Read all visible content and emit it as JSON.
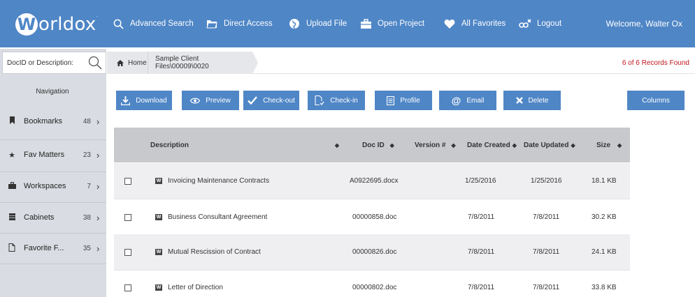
{
  "header": {
    "logo_letter": "W",
    "logo_text": "orldox",
    "nav": [
      {
        "label": "Advanced Search",
        "icon": "search-icon"
      },
      {
        "label": "Direct Access",
        "icon": "folder-icon"
      },
      {
        "label": "Upload File",
        "icon": "globe-icon"
      },
      {
        "label": "Open Project",
        "icon": "briefcase-icon"
      },
      {
        "label": "All Favorites",
        "icon": "heart-icon"
      },
      {
        "label": "Logout",
        "icon": "logout-icon"
      }
    ],
    "welcome": "Welcome, Walter Ox"
  },
  "sidebar": {
    "search_placeholder": "DocID or Description:",
    "title": "Navigation",
    "items": [
      {
        "label": "Bookmarks",
        "count": "48",
        "icon": "bookmark-icon"
      },
      {
        "label": "Fav Matters",
        "count": "23",
        "icon": "star-icon"
      },
      {
        "label": "Workspaces",
        "count": "7",
        "icon": "briefcase-icon"
      },
      {
        "label": "Cabinets",
        "count": "38",
        "icon": "cabinet-icon"
      },
      {
        "label": "Favorite F...",
        "count": "35",
        "icon": "file-icon"
      }
    ]
  },
  "breadcrumb": {
    "home": "Home",
    "path": "Sample Client Files\\00009\\0020",
    "records": "6 of 6 Records Found"
  },
  "toolbar": {
    "download": "Download",
    "preview": "Preview",
    "checkout": "Check-out",
    "checkin": "Check-in",
    "profile": "Profile",
    "email": "Email",
    "delete": "Delete",
    "columns": "Columns"
  },
  "table": {
    "headers": {
      "description": "Description",
      "docid": "Doc ID",
      "version": "Version #",
      "created": "Date Created",
      "updated": "Date Updated",
      "size": "Size"
    },
    "rows": [
      {
        "description": "Invoicing Maintenance Contracts",
        "docid": "A0922695.docx",
        "version": "",
        "created": "1/25/2016",
        "updated": "1/25/2016",
        "size": "18.1 KB"
      },
      {
        "description": "Business Consultant Agreement",
        "docid": "00000858.doc",
        "version": "",
        "created": "7/8/2011",
        "updated": "7/8/2011",
        "size": "30.2 KB"
      },
      {
        "description": "Mutual Rescission of Contract",
        "docid": "00000826.doc",
        "version": "",
        "created": "7/8/2011",
        "updated": "7/8/2011",
        "size": "24.1 KB"
      },
      {
        "description": "Letter of Direction",
        "docid": "00000802.doc",
        "version": "",
        "created": "7/8/2011",
        "updated": "7/8/2011",
        "size": "33.8 KB"
      }
    ]
  },
  "colors": {
    "brand": "#4f86c6",
    "sidebar": "#d9dce2",
    "records": "#c0141b"
  }
}
